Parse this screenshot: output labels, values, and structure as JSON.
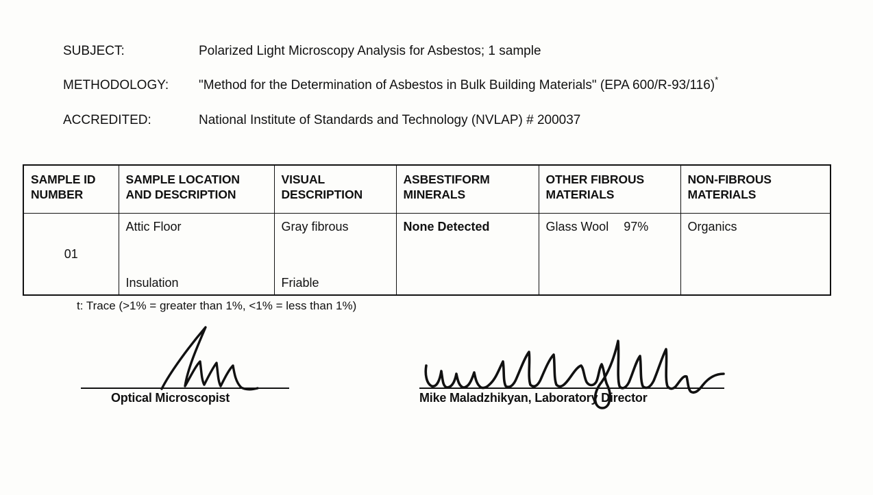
{
  "document": {
    "meta": [
      {
        "key": "subject",
        "label": "SUBJECT:",
        "value": "Polarized Light Microscopy Analysis for Asbestos; 1 sample",
        "superscript": ""
      },
      {
        "key": "methodology",
        "label": "METHODOLOGY:",
        "value": "\"Method for the Determination of Asbestos in Bulk Building Materials\" (EPA 600/R-93/116)",
        "superscript": "*"
      },
      {
        "key": "accredited",
        "label": "ACCREDITED:",
        "value": "National Institute of Standards and Technology (NVLAP) # 200037",
        "superscript": ""
      }
    ],
    "table": {
      "headers": [
        {
          "line1": "SAMPLE ID",
          "line2": "NUMBER"
        },
        {
          "line1": "SAMPLE LOCATION",
          "line2": "AND DESCRIPTION"
        },
        {
          "line1": "VISUAL",
          "line2": "DESCRIPTION"
        },
        {
          "line1": "ASBESTIFORM",
          "line2": "MINERALS"
        },
        {
          "line1": "OTHER FIBROUS",
          "line2": "MATERIALS"
        },
        {
          "line1": "NON-FIBROUS",
          "line2": "MATERIALS"
        }
      ],
      "rows": [
        {
          "sample_id": "01",
          "location_top": "Attic Floor",
          "location_bottom": "Insulation",
          "visual_top": "Gray fibrous",
          "visual_bottom": "Friable",
          "asbestiform_minerals": "None Detected",
          "other_fibrous_material": "Glass Wool",
          "other_fibrous_percent": "97%",
          "non_fibrous_materials": "Organics"
        }
      ]
    },
    "footnote": "t: Trace (>1% = greater than 1%, <1% = less than 1%)",
    "signatures": [
      {
        "key": "optical-microscopist",
        "caption": "Optical Microscopist",
        "signed": true
      },
      {
        "key": "laboratory-director",
        "caption": "Mike Maladzhikyan, Laboratory Director",
        "signed": true
      }
    ]
  },
  "colors": {
    "page_background": "#fdfdfb",
    "ink": "#111111",
    "rule": "#111111"
  }
}
